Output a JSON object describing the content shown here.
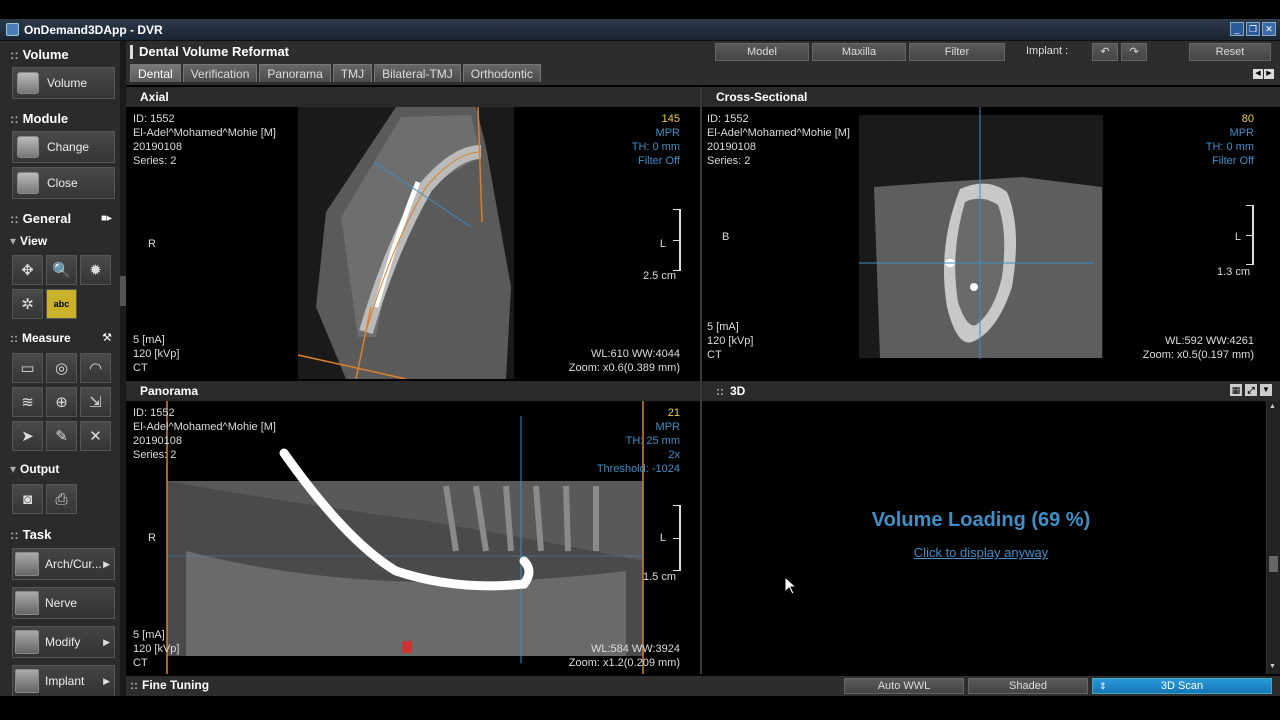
{
  "window": {
    "title": "OnDemand3DApp - DVR"
  },
  "sidebar": {
    "volume_section": "Volume",
    "volume_button": "Volume",
    "module_section": "Module",
    "change_button": "Change",
    "close_button": "Close",
    "general_section": "General",
    "view_sub": "View",
    "abc_tool": "abc",
    "measure_sub": "Measure",
    "output_sub": "Output",
    "task_section": "Task",
    "tasks": [
      "Arch/Cur...",
      "Nerve",
      "Modify",
      "Implant"
    ]
  },
  "header": {
    "title": "Dental Volume Reformat",
    "buttons": [
      "Model",
      "Maxilla",
      "Filter"
    ],
    "implant_label": "Implant :",
    "reset": "Reset",
    "tabs": [
      "Dental",
      "Verification",
      "Panorama",
      "TMJ",
      "Bilateral-TMJ",
      "Orthodontic"
    ],
    "active_tab": "Dental"
  },
  "axial": {
    "title": "Axial",
    "patient": "ID: 1552\nEl-Adel^Mohamed^Mohie [M]\n20190108\nSeries: 2",
    "slice": "145",
    "info": "MPR\nTH: 0 mm\nFilter Off",
    "orient_left": "R",
    "orient_right": "L",
    "scale_label": "2.5 cm",
    "acq": "5 [mA]\n120 [kVp]\nCT",
    "wl": "WL:610 WW:4044\nZoom: x0.6(0.389 mm)"
  },
  "cross": {
    "title": "Cross-Sectional",
    "patient": "ID: 1552\nEl-Adel^Mohamed^Mohie [M]\n20190108\nSeries: 2",
    "slice": "80",
    "info": "MPR\nTH: 0 mm\nFilter Off",
    "orient_left": "B",
    "orient_right": "L",
    "scale_label": "1.3 cm",
    "acq": "5 [mA]\n120 [kVp]\nCT",
    "wl": "WL:592 WW:4261\nZoom: x0.5(0.197 mm)"
  },
  "panorama": {
    "title": "Panorama",
    "patient": "ID: 1552\nEl-Adel^Mohamed^Mohie [M]\n20190108\nSeries: 2",
    "slice": "21",
    "info": "MPR\nTH: 25 mm\n2x\nThreshold: -1024",
    "orient_left": "R",
    "orient_right": "L",
    "scale_label": "1.5 cm",
    "acq": "5 [mA]\n120 [kVp]\nCT",
    "wl": "WL:584 WW:3924\nZoom: x1.2(0.209 mm)"
  },
  "view3d": {
    "title": "3D",
    "loading": "Volume Loading (69 %)",
    "display_link": "Click to display anyway"
  },
  "bottom": {
    "fine_tuning": "Fine Tuning",
    "auto_wwl": "Auto WWL",
    "shaded": "Shaded",
    "scan": "3D Scan"
  },
  "colors": {
    "accent_blue": "#3f8ec8",
    "slice_yellow": "#e8d44a",
    "guide_orange": "#d9822b"
  }
}
